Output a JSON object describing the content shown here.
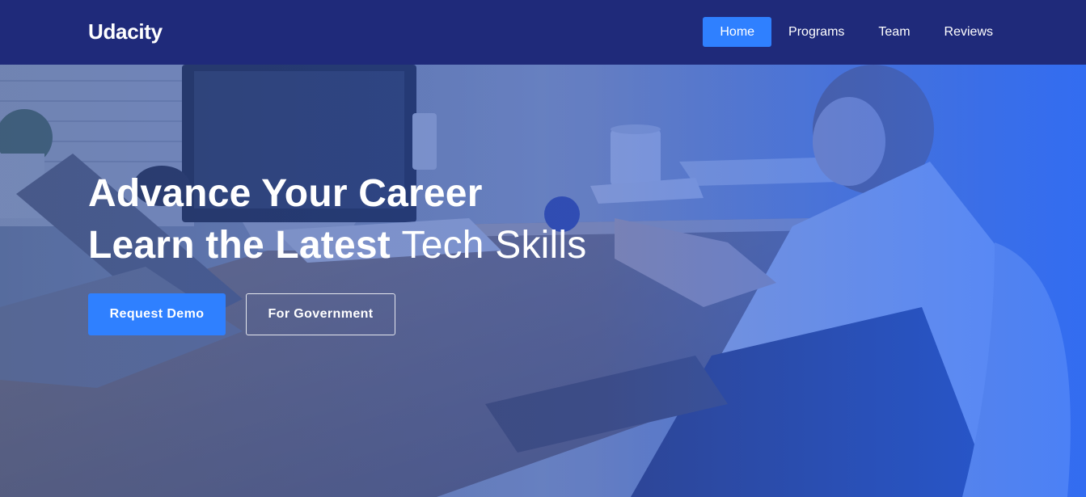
{
  "brand": {
    "name": "Udacity"
  },
  "nav": {
    "items": [
      {
        "label": "Home",
        "active": true
      },
      {
        "label": "Programs",
        "active": false
      },
      {
        "label": "Team",
        "active": false
      },
      {
        "label": "Reviews",
        "active": false
      }
    ]
  },
  "hero": {
    "headline_line1": "Advance Your Career",
    "headline_line2_bold": "Learn the Latest",
    "headline_line2_light": "Tech Skills",
    "primary_button": "Request Demo",
    "secondary_button": "For Government"
  },
  "colors": {
    "nav_bg": "#1f2a7a",
    "accent": "#2f80ff",
    "text": "#ffffff"
  }
}
